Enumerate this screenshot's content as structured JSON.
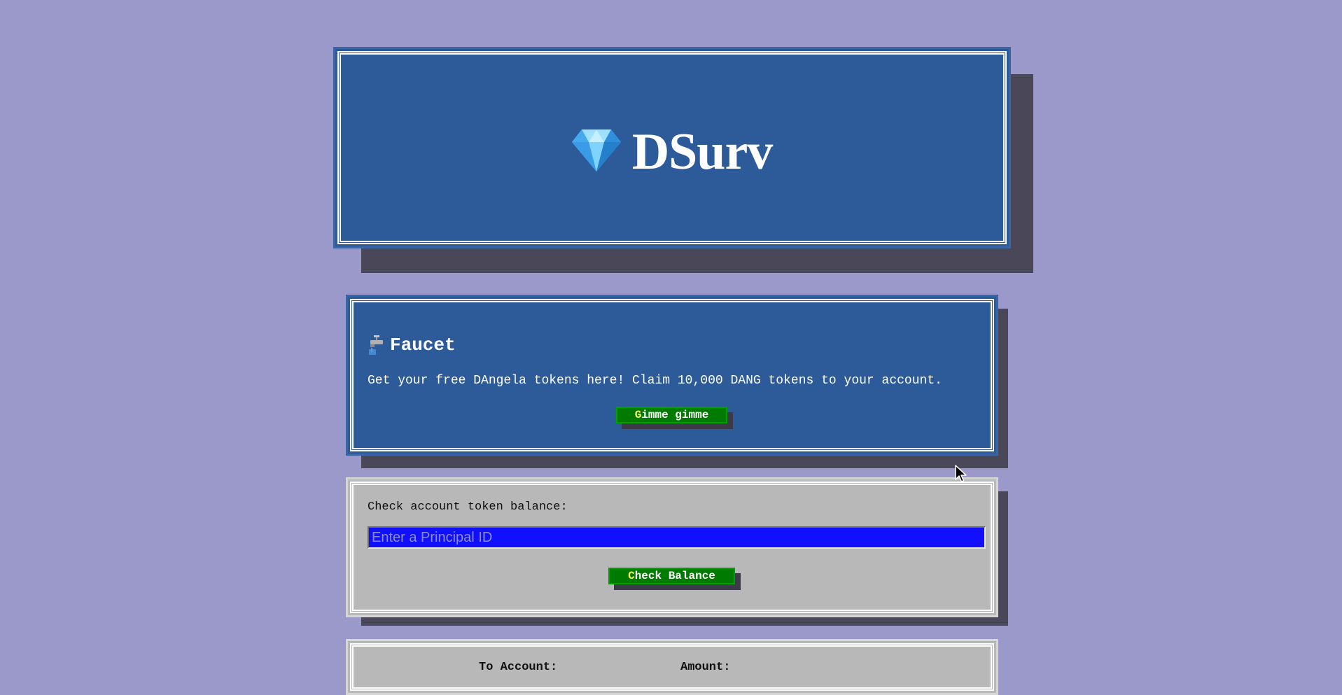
{
  "header": {
    "app_name": "DSurv",
    "logo_icon": "diamond-icon"
  },
  "faucet": {
    "icon": "faucet-icon",
    "title": "Faucet",
    "description": "Get your free DAngela tokens here! Claim 10,000 DANG tokens to your account.",
    "button_hotkey": "G",
    "button_rest": "imme gimme"
  },
  "balance": {
    "label": "Check account token balance:",
    "input_value": "",
    "input_placeholder": "Enter a Principal ID",
    "button_hotkey": "C",
    "button_rest": "heck Balance"
  },
  "transfer": {
    "to_account_label": "To Account:",
    "amount_label": "Amount:"
  },
  "colors": {
    "page_background": "#9b99c9",
    "primary_card": "#2d5b99",
    "secondary_card": "#b8b8b8",
    "button_green": "#007a00",
    "input_blue": "#1010ff"
  }
}
